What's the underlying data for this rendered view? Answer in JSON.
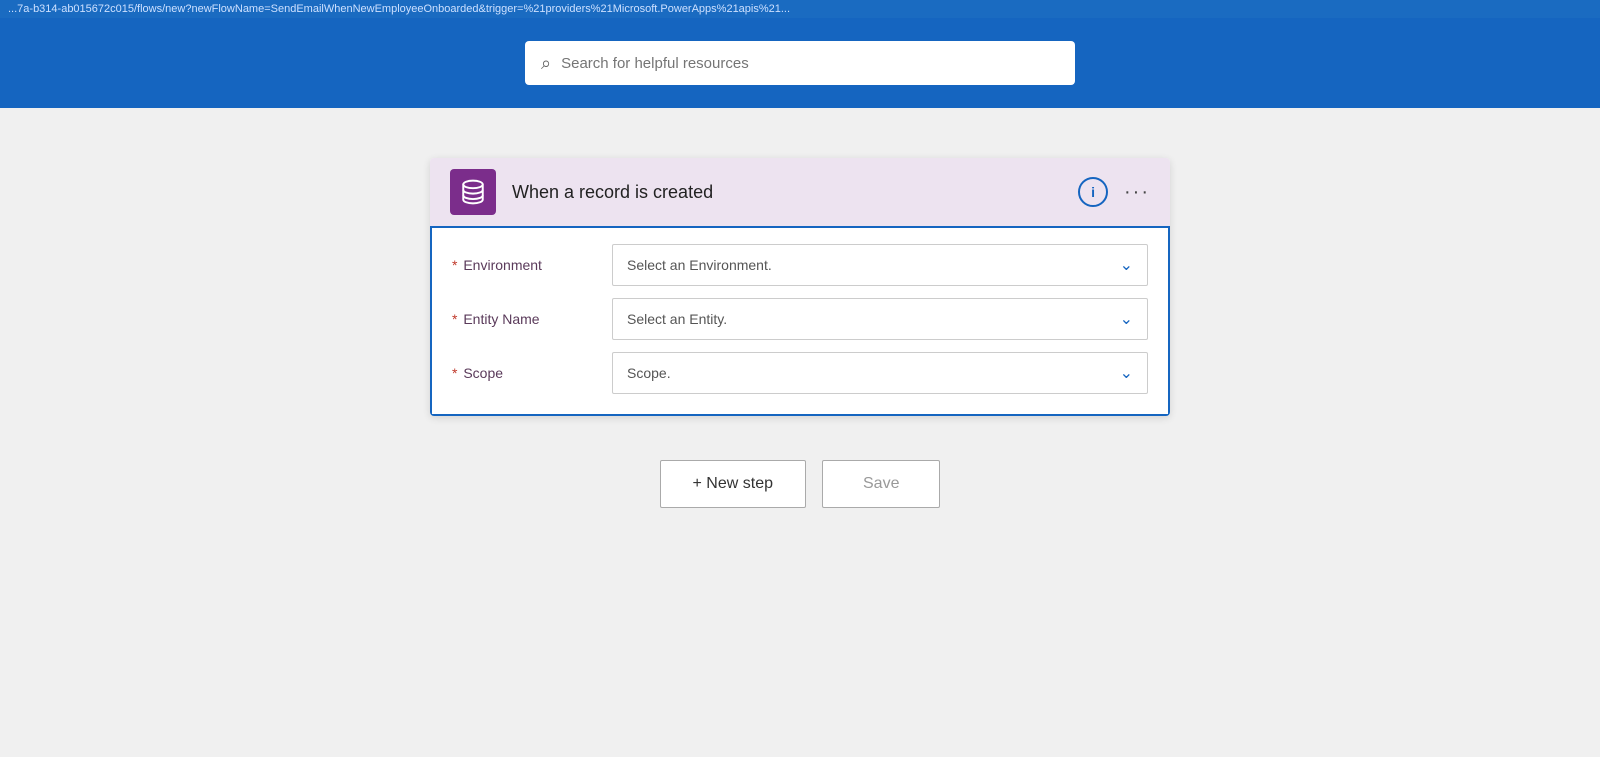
{
  "url_bar": {
    "text": "...7a-b314-ab015672c015/flows/new?newFlowName=SendEmailWhenNewEmployeeOnboarded&trigger=%21providers%21Microsoft.PowerApps%21apis%21..."
  },
  "header": {
    "search_placeholder": "Search for helpful resources"
  },
  "card": {
    "title": "When a record is created",
    "icon_label": "database-icon",
    "info_label": "i",
    "more_label": "···",
    "fields": [
      {
        "label": "Environment",
        "required": true,
        "placeholder": "Select an Environment.",
        "id": "environment-select"
      },
      {
        "label": "Entity Name",
        "required": true,
        "placeholder": "Select an Entity.",
        "id": "entity-name-select"
      },
      {
        "label": "Scope",
        "required": true,
        "placeholder": "Scope.",
        "id": "scope-select"
      }
    ]
  },
  "actions": {
    "new_step_label": "+ New step",
    "save_label": "Save"
  }
}
